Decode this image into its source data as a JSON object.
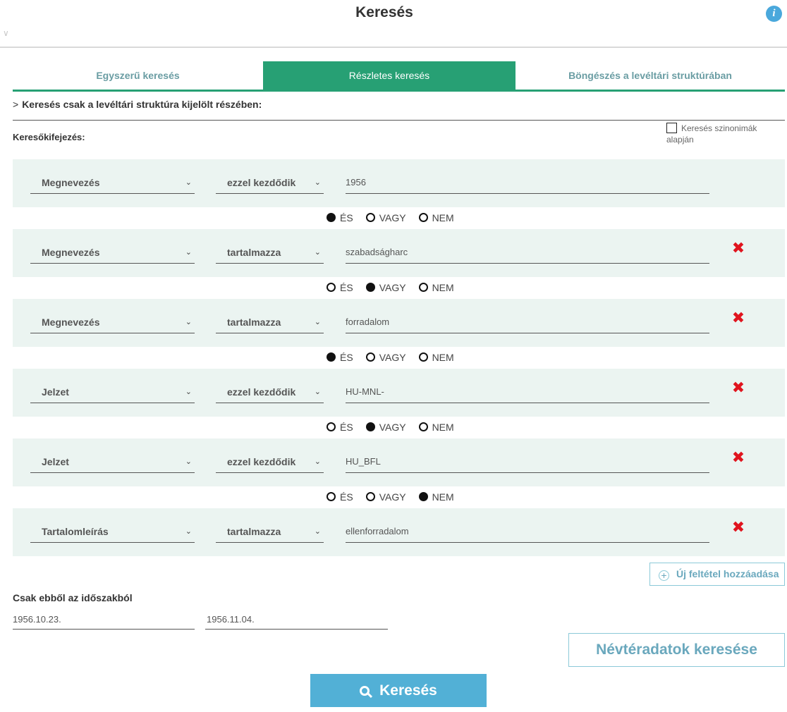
{
  "header": {
    "title": "Keresés",
    "info_icon": "info-icon",
    "collapse_icon": "chevron-down-icon"
  },
  "tabs": [
    {
      "label": "Egyszerű keresés",
      "active": false
    },
    {
      "label": "Részletes keresés",
      "active": true
    },
    {
      "label": "Böngészés a levéltári struktúrában",
      "active": false
    }
  ],
  "structure": {
    "label": "Keresés csak a levéltári struktúra kijelölt részében:"
  },
  "expression": {
    "label": "Keresőkifejezés:"
  },
  "synonyms": {
    "label": "Keresés szinonimák alapján",
    "checked": false
  },
  "operators": {
    "and": "ÉS",
    "or": "VAGY",
    "not": "NEM"
  },
  "conditions": [
    {
      "field": "Megnevezés",
      "match": "ezzel kezdődik",
      "value": "1956",
      "removable": false
    },
    {
      "field": "Megnevezés",
      "match": "tartalmazza",
      "value": "szabadságharc",
      "removable": true
    },
    {
      "field": "Megnevezés",
      "match": "tartalmazza",
      "value": "forradalom",
      "removable": true
    },
    {
      "field": "Jelzet",
      "match": "ezzel kezdődik",
      "value": "HU-MNL-",
      "removable": true
    },
    {
      "field": "Jelzet",
      "match": "ezzel kezdődik",
      "value": "HU_BFL",
      "removable": true
    },
    {
      "field": "Tartalomleírás",
      "match": "tartalmazza",
      "value": "ellenforradalom",
      "removable": true
    }
  ],
  "connectors": [
    "and",
    "or",
    "and",
    "or",
    "not"
  ],
  "add_condition": {
    "label": "Új feltétel hozzáadása"
  },
  "period": {
    "label": "Csak ebből az időszakból",
    "from": "1956.10.23.",
    "to": "1956.11.04."
  },
  "namespace_button": {
    "label": "Névtéradatok keresése"
  },
  "search_button": {
    "label": "Keresés"
  },
  "colors": {
    "accent": "#27a074",
    "button": "#52b0d6",
    "delete": "#e0141e",
    "row_bg": "#ebf4f1"
  }
}
